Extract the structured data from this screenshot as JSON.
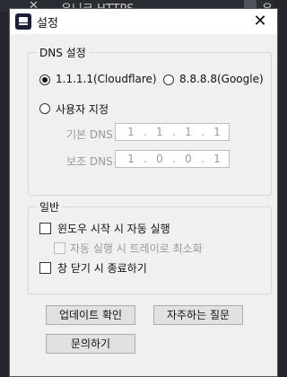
{
  "background": {
    "tab_text": "유니크 HTTPS",
    "tab_text_right": "유니"
  },
  "dialog": {
    "title": "설정",
    "dns": {
      "group_label": "DNS 설정",
      "options": [
        {
          "label": "1.1.1.1(Cloudflare)",
          "selected": true
        },
        {
          "label": "8.8.8.8(Google)",
          "selected": false
        },
        {
          "label": "사용자 지정",
          "selected": false
        }
      ],
      "primary": {
        "label": "기본 DNS",
        "octets": [
          "1",
          "1",
          "1",
          "1"
        ]
      },
      "secondary": {
        "label": "보조 DNS",
        "octets": [
          "1",
          "0",
          "0",
          "1"
        ]
      }
    },
    "general": {
      "group_label": "일반",
      "checkboxes": [
        {
          "label": "윈도우 시작 시 자동 실행",
          "checked": false,
          "enabled": true
        },
        {
          "label": "자동 실행 시 트레이로 최소화",
          "checked": false,
          "enabled": false
        },
        {
          "label": "창 닫기 시 종료하기",
          "checked": false,
          "enabled": true
        }
      ]
    },
    "buttons": {
      "update": "업데이트 확인",
      "faq": "자주하는 질문",
      "contact": "문의하기"
    }
  }
}
